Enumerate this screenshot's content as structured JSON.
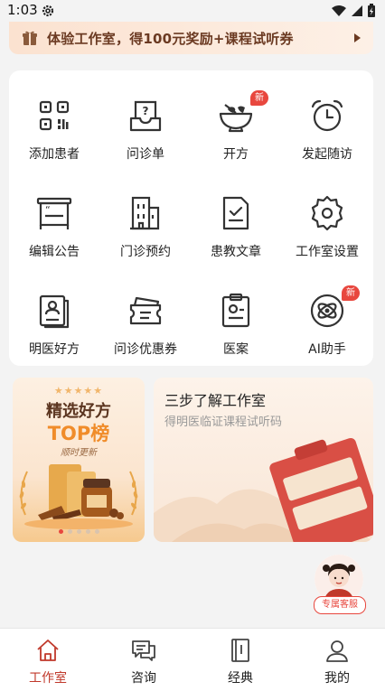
{
  "status_bar": {
    "time": "1:03"
  },
  "promo": {
    "text": "体验工作室，得100元奖励+课程试听券"
  },
  "grid": {
    "items": [
      {
        "label": "添加患者",
        "icon": "qr-code-icon"
      },
      {
        "label": "问诊单",
        "icon": "question-tray-icon"
      },
      {
        "label": "开方",
        "icon": "mortar-pestle-icon",
        "badge": "新"
      },
      {
        "label": "发起随访",
        "icon": "alarm-clock-icon"
      },
      {
        "label": "编辑公告",
        "icon": "notice-board-icon"
      },
      {
        "label": "门诊预约",
        "icon": "clinic-building-icon"
      },
      {
        "label": "患教文章",
        "icon": "document-check-icon"
      },
      {
        "label": "工作室设置",
        "icon": "settings-gear-icon"
      },
      {
        "label": "明医好方",
        "icon": "doctor-prescription-icon"
      },
      {
        "label": "问诊优惠券",
        "icon": "coupon-icon"
      },
      {
        "label": "医案",
        "icon": "case-file-icon"
      },
      {
        "label": "AI助手",
        "icon": "ai-atom-icon",
        "badge": "新"
      }
    ]
  },
  "top_card": {
    "stars": "★★★★★",
    "title": "精选好方",
    "title2": "TOP榜",
    "subtitle": "顺时更新",
    "carousel_pages": 5,
    "active_page": 1
  },
  "steps_card": {
    "title": "三步了解工作室",
    "subtitle": "得明医临证课程试听码"
  },
  "customer_service": {
    "label": "专属客服"
  },
  "bottom_nav": {
    "items": [
      {
        "label": "工作室",
        "icon": "home-icon",
        "active": true
      },
      {
        "label": "咨询",
        "icon": "chat-icon",
        "active": false
      },
      {
        "label": "经典",
        "icon": "book-icon",
        "active": false
      },
      {
        "label": "我的",
        "icon": "user-icon",
        "active": false
      }
    ]
  },
  "colors": {
    "accent": "#c0392b",
    "badge": "#e8473e",
    "promo_text": "#6b3a22",
    "background": "#f3f3f3"
  }
}
